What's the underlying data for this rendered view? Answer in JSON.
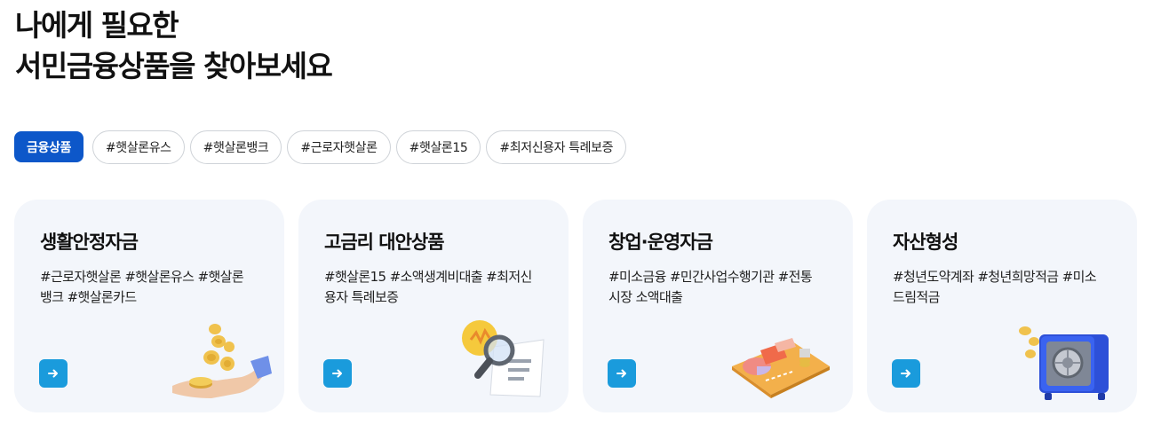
{
  "headline": {
    "line1": "나에게 필요한",
    "line2": "서민금융상품을 찾아보세요"
  },
  "tags": {
    "active": "금융상품",
    "items": [
      "#햇살론유스",
      "#햇살론뱅크",
      "#근로자햇살론",
      "#햇살론15",
      "#최저신용자 특례보증"
    ]
  },
  "cards": [
    {
      "title": "생활안정자금",
      "tags": "#근로자햇살론 #햇살론유스 #햇살론뱅크 #햇살론카드",
      "icon": "coins-hand-icon"
    },
    {
      "title": "고금리 대안상품",
      "tags": "#햇살론15 #소액생계비대출 #최저신용자 특례보증",
      "icon": "magnifier-document-icon"
    },
    {
      "title": "창업·운영자금",
      "tags": "#미소금융 #민간사업수행기관 #전통시장 소액대출",
      "icon": "business-chart-icon"
    },
    {
      "title": "자산형성",
      "tags": "#청년도약계좌 #청년희망적금 #미소드림적금",
      "icon": "safe-icon"
    }
  ],
  "colors": {
    "accent": "#0d57c9",
    "arrow_button": "#1a9bdc",
    "card_bg": "#f3f6fb"
  }
}
